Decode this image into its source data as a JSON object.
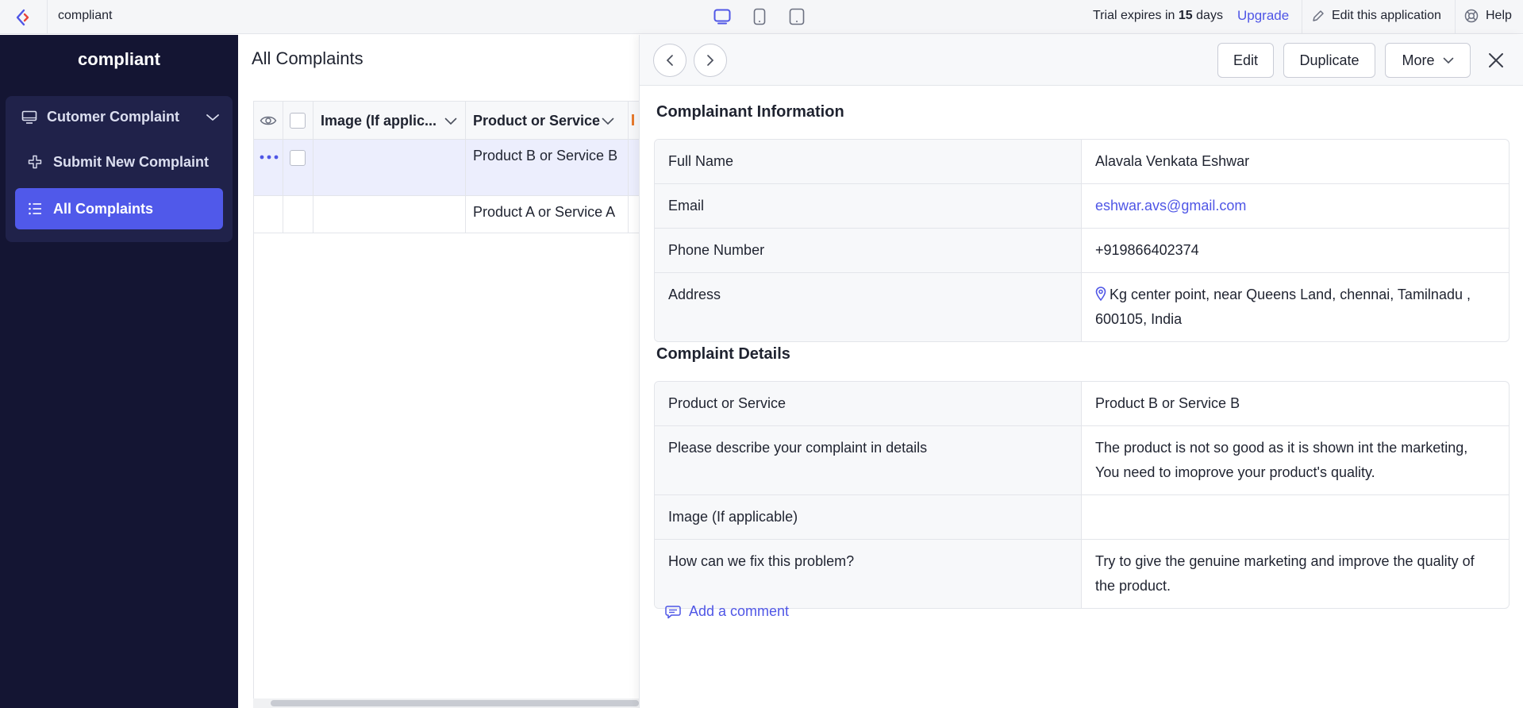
{
  "topbar": {
    "app_name": "compliant",
    "trial_prefix": "Trial expires in",
    "trial_days": "15",
    "trial_suffix": "days",
    "upgrade_label": "Upgrade",
    "edit_app_label": "Edit this application",
    "help_label": "Help",
    "accent": "#4f56e6"
  },
  "sidebar": {
    "title": "compliant",
    "group_label": "Cutomer Complaint",
    "items": [
      {
        "label": "Submit New Complaint",
        "icon": "plus-icon",
        "active": false
      },
      {
        "label": "All Complaints",
        "icon": "list-icon",
        "active": true
      }
    ],
    "bg_color": "#141533",
    "active_color": "#5059ea"
  },
  "main": {
    "title": "All Complaints",
    "columns": [
      "Image (If applic...",
      "Product or Service"
    ],
    "rows": [
      {
        "product": "Product B or Service B",
        "selected": true
      },
      {
        "product": "Product A or Service A",
        "selected": false
      }
    ]
  },
  "panel": {
    "buttons": {
      "edit": "Edit",
      "duplicate": "Duplicate",
      "more": "More"
    },
    "sections": [
      {
        "title": "Complainant Information",
        "rows": [
          {
            "label": "Full Name",
            "value": "Alavala Venkata Eshwar"
          },
          {
            "label": "Email",
            "value": "eshwar.avs@gmail.com"
          },
          {
            "label": "Phone Number",
            "value": "+919866402374"
          },
          {
            "label": "Address",
            "value": "Kg center point, near Queens Land, chennai, Tamilnadu , 600105, India"
          }
        ]
      },
      {
        "title": "Complaint Details",
        "rows": [
          {
            "label": "Product or Service",
            "value": "Product B or Service B"
          },
          {
            "label": "Please describe your complaint in details",
            "value": "The product is not so good as it is shown int the marketing, You need to imoprove your product's quality."
          },
          {
            "label": "Image (If applicable)",
            "value": ""
          },
          {
            "label": "How can we fix this problem?",
            "value": "Try to give the genuine marketing and improve the quality of the product."
          }
        ]
      }
    ],
    "add_comment_label": "Add a comment"
  }
}
